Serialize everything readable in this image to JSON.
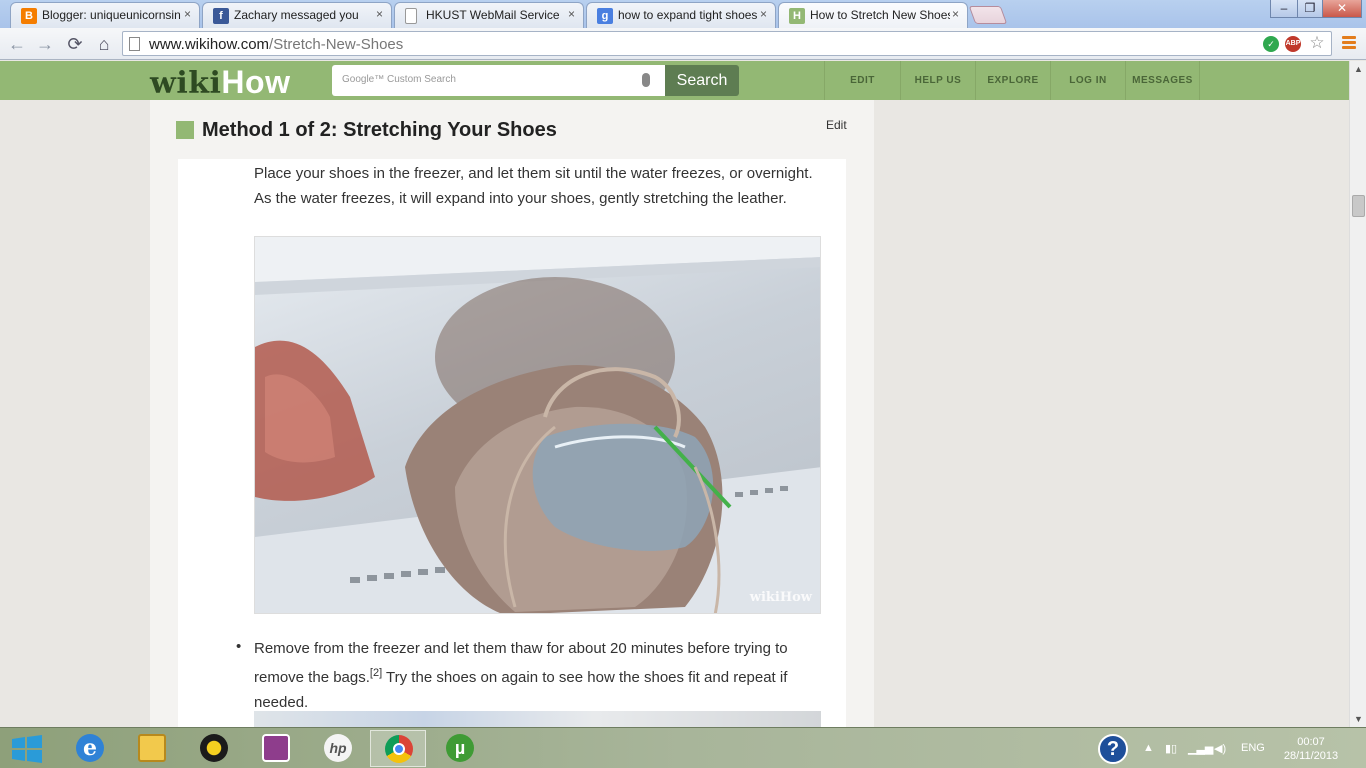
{
  "browser": {
    "tabs": [
      {
        "title": "Blogger: uniqueunicornsin",
        "favicon": "blogger-icon",
        "color": "#f57d00",
        "glyph": "B"
      },
      {
        "title": "Zachary messaged you",
        "favicon": "facebook-icon",
        "color": "#3b5998",
        "glyph": "f"
      },
      {
        "title": "HKUST WebMail Service",
        "favicon": "page-icon",
        "color": "#ffffff",
        "glyph": ""
      },
      {
        "title": "how to expand tight shoes",
        "favicon": "google-icon",
        "color": "#4a7fe0",
        "glyph": "g"
      },
      {
        "title": "How to Stretch New Shoes",
        "favicon": "wikihow-icon",
        "color": "#93b874",
        "glyph": "H"
      }
    ],
    "close_glyph": "×",
    "url_host": "www.wikihow.com",
    "url_path": "/Stretch-New-Shoes",
    "window_buttons": [
      "–",
      "❐",
      "✕"
    ],
    "nav_glyphs": {
      "back": "←",
      "forward": "→",
      "reload": "⟳",
      "home": "⌂"
    }
  },
  "wikihow": {
    "logo_wiki": "wiki",
    "logo_how": "How",
    "search_placeholder": "Google™ Custom Search",
    "search_button": "Search",
    "nav": [
      "EDIT",
      "HELP US",
      "EXPLORE",
      "LOG IN",
      "MESSAGES"
    ],
    "brand_color": "#93b874"
  },
  "article": {
    "method_title": "Method 1 of 2: Stretching Your Shoes",
    "edit_label": "Edit",
    "step_text": "Place your shoes in the freezer, and let them sit until the water freezes, or overnight. As the water freezes, it will expand into your shoes, gently stretching the leather.",
    "photo_watermark": "wikiHow",
    "bullet_text_before": "Remove from the freezer and let them thaw for about 20 minutes before trying to remove the bags.",
    "citation": "[2]",
    "bullet_text_after": " Try the shoes on again to see how the shoes fit and repeat if needed."
  },
  "taskbar": {
    "apps": [
      "windows-start-icon",
      "internet-explorer-icon",
      "file-explorer-icon",
      "media-player-icon",
      "remote-app-icon",
      "hp-icon",
      "chrome-icon",
      "utorrent-icon"
    ],
    "language": "ENG",
    "time": "00:07",
    "date": "28/11/2013",
    "help_glyph": "?"
  }
}
